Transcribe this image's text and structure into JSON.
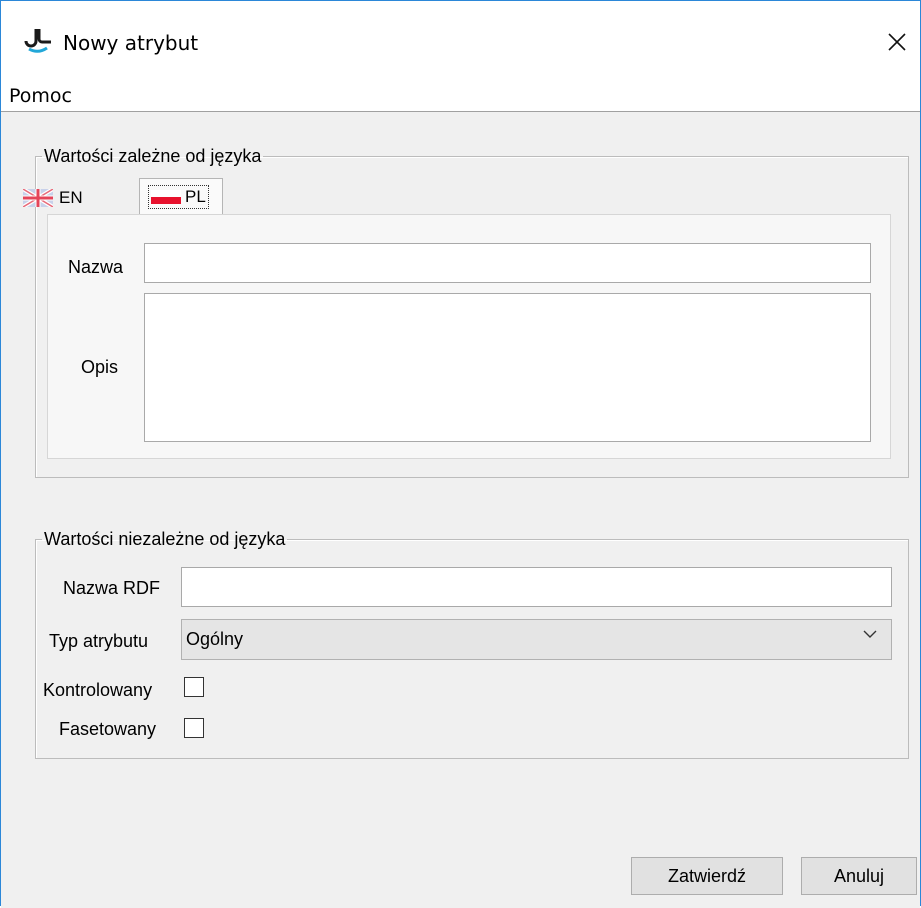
{
  "window": {
    "title": "Nowy atrybut"
  },
  "menu": {
    "items": [
      {
        "label": "Pomoc"
      }
    ]
  },
  "language_group": {
    "title": "Wartości zależne od języka",
    "tabs": [
      {
        "label": "EN",
        "icon": "uk-flag-icon"
      },
      {
        "label": "PL",
        "icon": "poland-flag-icon",
        "selected": true
      }
    ],
    "fields": {
      "name_label": "Nazwa",
      "name_value": "",
      "desc_label": "Opis",
      "desc_value": ""
    }
  },
  "neutral_group": {
    "title": "Wartości niezależne od języka",
    "rdf_label": "Nazwa RDF",
    "rdf_value": "",
    "type_label": "Typ atrybutu",
    "type_value": "Ogólny",
    "controlled_label": "Kontrolowany",
    "controlled_checked": false,
    "faceted_label": "Fasetowany",
    "faceted_checked": false
  },
  "buttons": {
    "confirm": "Zatwierdź",
    "cancel": "Anuluj"
  },
  "colors": {
    "accent_border": "#2b87d8",
    "dialog_bg": "#f0f0f0",
    "button_bg": "#e1e1e1"
  }
}
